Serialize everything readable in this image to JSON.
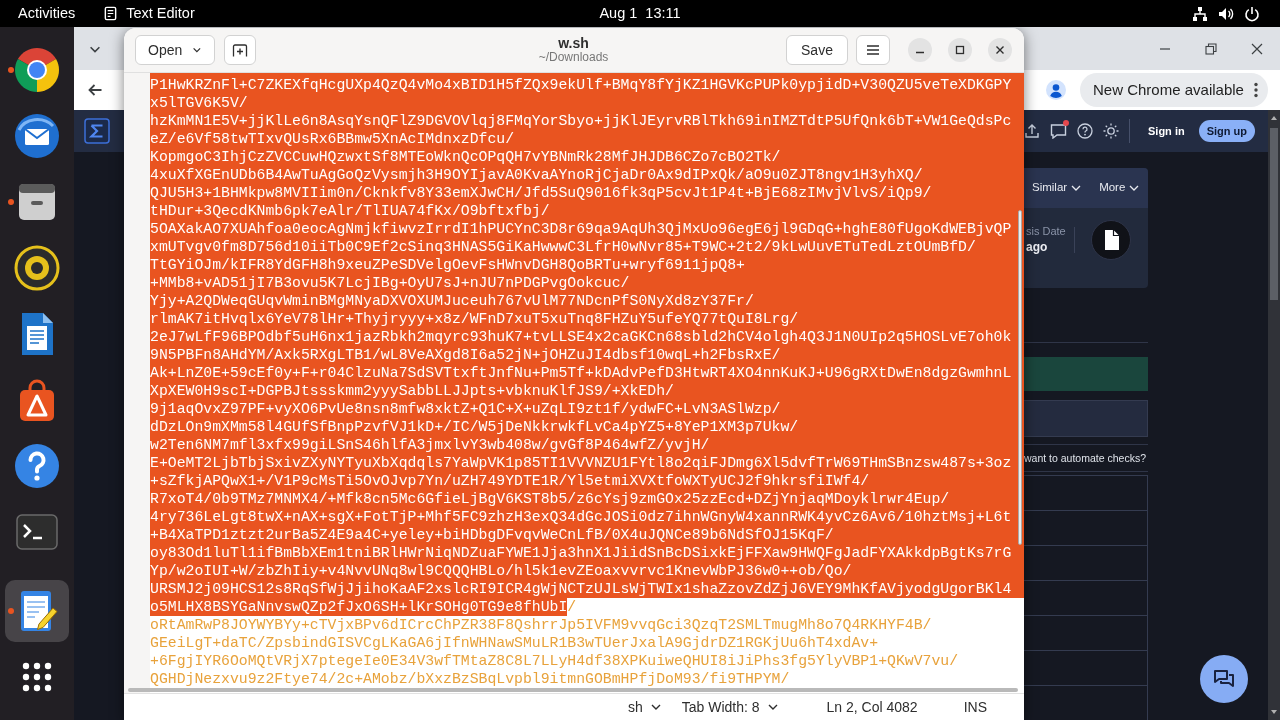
{
  "top_bar": {
    "activities": "Activities",
    "app_name": "Text Editor",
    "clock": "Aug 1  13:11"
  },
  "dock": {
    "favorites": [
      {
        "kind": "browser",
        "running": true,
        "selected": false
      },
      {
        "kind": "mail",
        "running": false,
        "selected": false
      },
      {
        "kind": "files",
        "running": true,
        "selected": false
      },
      {
        "kind": "music",
        "running": false,
        "selected": false
      },
      {
        "kind": "writer",
        "running": false,
        "selected": false
      },
      {
        "kind": "store",
        "running": false,
        "selected": false
      },
      {
        "kind": "help",
        "running": false,
        "selected": false
      },
      {
        "kind": "terminal",
        "running": false,
        "selected": false
      }
    ],
    "running_apps": [
      {
        "kind": "editor",
        "running": true,
        "selected": true
      }
    ]
  },
  "browser": {
    "update_button": "New Chrome available",
    "page": {
      "sign_in": "Sign in",
      "sign_up": "Sign up",
      "card_tabs": [
        "Similar",
        "More"
      ],
      "date_label": "sis Date",
      "date_value": "ago",
      "automate_prompt": "want to automate checks?"
    }
  },
  "editor": {
    "open_button": "Open",
    "title": "w.sh",
    "subtitle": "~/Downloads",
    "save_button": "Save",
    "lines": [
      {
        "runs": [
          {
            "text": "P1HwKRZnFl+C7ZKEXfqHcgUXp4QzQ4vMo4xBID1H5fZQx9ekUlf+BMqY8fYjKZ1HGVKcPUPk0ypjidD+V30QZU5veTeXDKGPY",
            "selected": true
          }
        ]
      },
      {
        "runs": [
          {
            "text": "x5lTGV6K5V/",
            "selected": true
          }
        ]
      },
      {
        "runs": [
          {
            "text": "hzKmMN1E5V+jjKlLe6n8AsqYsnQFlZ9DGVOVlqj8FMqYorSbyo+jjKlJEyrvRBlTkh69inIMZTdtP5UfQnk6bT+VW1GeQdsPc",
            "selected": true
          }
        ]
      },
      {
        "runs": [
          {
            "text": "eZ/e6Vf58twTIxvQUsRx6BBmw5XnAcIMdnxzDfcu/",
            "selected": true
          }
        ]
      },
      {
        "runs": [
          {
            "text": "KopmgoC3IhjCzZVCCuwHQzwxtSf8MTEoWknQcOPqQH7vYBNmRk28MfJHJDB6CZo7cBO2Tk/",
            "selected": true
          }
        ]
      },
      {
        "runs": [
          {
            "text": "4xuXfXGEnUDb6B4AwTuAgGoQzVysmjh3H9OYIjavA0KvaAYnoRjCjaDr0Ax9dIPxQk/aO9u0ZJT8ngv1H3yhXQ/",
            "selected": true
          }
        ]
      },
      {
        "runs": [
          {
            "text": "QJU5H3+1BHMkpw8MVIIim0n/Cknkfv8Y33emXJwCH/Jfd5SuQ9016fk3qP5cvJt1P4t+BjE68zIMvjVlvS/iQp9/",
            "selected": true
          }
        ]
      },
      {
        "runs": [
          {
            "text": "tHDur+3QecdKNmb6pk7eAlr/TlIUA74fKx/O9bftxfbj/",
            "selected": true
          }
        ]
      },
      {
        "runs": [
          {
            "text": "5OAXakAO7XUAhfoa0eocAgNmjkfiwvzIrrdI1hPUCYnC3D8r69qa9AqUh3QjMxUo96egE6jl9GDqG+hghE80fUgoKdWEBjvQP",
            "selected": true
          }
        ]
      },
      {
        "runs": [
          {
            "text": "xmUTvgv0fm8D756d10iiTb0C9Ef2cSinq3HNAS5GiKaHwwwC3LfrH0wNvr85+T9WC+2t2/9kLwUuvETuTedLztOUmBfD/",
            "selected": true
          }
        ]
      },
      {
        "runs": [
          {
            "text": "TtGYiOJm/kIFR8YdGFH8h9xeuZPeSDVelgOevFsHWnvDGH8QoBRTu+wryf6911jpQ8+",
            "selected": true
          }
        ]
      },
      {
        "runs": [
          {
            "text": "+MMb8+vAD51jI7B3ovu5K7LcjIBg+OyU7sJ+nJU7nPDGPvgOokcuc/",
            "selected": true
          }
        ]
      },
      {
        "runs": [
          {
            "text": "Yjy+A2QDWeqGUqvWminBMgMNyaDXVOXUMJuceuh767vUlM77NDcnPfS0NyXd8zY37Fr/",
            "selected": true
          }
        ]
      },
      {
        "runs": [
          {
            "text": "rlmAK7itHvqlx6YeV78lHr+Thyjryyy+x8z/WFnD7xuT5xuTnq8FHZuY5ufeYQ77tQuI8Lrg/",
            "selected": true
          }
        ]
      },
      {
        "runs": [
          {
            "text": "2eJ7wLfF96BPOdbf5uH6nx1jazRbkh2mqyrc93huK7+tvLLSE4x2caGKCn68sbld2hCV4olgh4Q3J1N0UIp2q5HOSLvE7oh0k",
            "selected": true
          }
        ]
      },
      {
        "runs": [
          {
            "text": "9N5PBFn8AHdYM/Axk5RXgLTB1/wL8VeAXgd8I6a52jN+jOHZuJI4dbsf10wqL+h2FbsRxE/",
            "selected": true
          }
        ]
      },
      {
        "runs": [
          {
            "text": "Ak+LnZ0E+59cEf0y+F+r04ClzuNa7SdSVTtxftJnfNu+Pm5Tf+kDAdvPefD3HtwRT4XO4nnKuKJ+U96gRXtDwEn8dgzGwmhnL",
            "selected": true
          }
        ]
      },
      {
        "runs": [
          {
            "text": "XpXEW0H9scI+DGPBJtssskmm2yyySabbLLJJpts+vbknuKlfJS9/+XkEDh/",
            "selected": true
          }
        ]
      },
      {
        "runs": [
          {
            "text": "9j1aqOvxZ97PF+vyXO6PvUe8nsn8mfw8xktZ+Q1C+X+uZqLI9zt1f/ydwFC+LvN3ASlWzp/",
            "selected": true
          }
        ]
      },
      {
        "runs": [
          {
            "text": "dDzLOn9mXMm58l4GUfSfBnpPzvfVJ1kD+/IC/W5jDeNkkrwkfLvCa4pYZ5+8YeP1XM3p7Ukw/",
            "selected": true
          }
        ]
      },
      {
        "runs": [
          {
            "text": "w2Ten6NM7mfl3xfx99giLSnS46hlfA3jmxlvY3wb408w/gvGf8P464wfZ/yvjH/",
            "selected": true
          }
        ]
      },
      {
        "runs": [
          {
            "text": "E+OeMT2LjbTbjSxivZXyNYTyuXbXqdqls7YaWpVK1p85TI1VVVNZU1FYtl8o2qiFJDmg6Xl5dvfTrW69THmSBnzsw487s+3oz",
            "selected": true
          }
        ]
      },
      {
        "runs": [
          {
            "text": "+sZfkjAPQwX1+/V1P9cMsTi5OvOJvp7Yn/uZH749YDTE1R/Yl5etmiXVXtfoWXTyUCJ2f9hkrsfiIWf4/",
            "selected": true
          }
        ]
      },
      {
        "runs": [
          {
            "text": "R7xoT4/0b9TMz7MNMX4/+Mfk8cn5Mc6GfieLjBgV6KST8b5/z6cYsj9zmGOx25zzEcd+DZjYnjaqMDoyklrwr4Eup/",
            "selected": true
          }
        ]
      },
      {
        "runs": [
          {
            "text": "4ry736LeLgt8twX+nAX+sgX+FotTjP+Mhf5FC9zhzH3exQ34dGcJOSi0dz7ihnWGnyW4xannRWK4yvCz6Av6/10hztMsj+L6t",
            "selected": true
          }
        ]
      },
      {
        "runs": [
          {
            "text": "+B4XaTPD1ztzt2urBa5Z4E9a4C+yeley+biHDbgDFvqvWeCnLfB/0X4uJQNCe89b6NdSfOJ15KqF/",
            "selected": true
          }
        ]
      },
      {
        "runs": [
          {
            "text": "oy83Od1luTl1ifBmBbXEm1tniBRlHWrNiqNDZuaFYWE1Jja3hnX1JiidSnBcDSixkEjFFXaw9HWQFgJadFYXAkkdpBgtKs7rG",
            "selected": true
          }
        ]
      },
      {
        "runs": [
          {
            "text": "Yp/w2oIUI+W/zbZhIiy+v4NvvUNq8wl9CQQQHBLo/hl5k1evZEoaxvvrvc1KnevWbPJ36w0++ob/Qo/",
            "selected": true
          }
        ]
      },
      {
        "runs": [
          {
            "text": "URSMJ2j09HCS12s8RqSfWjJjihoKaAF2xslcRI9ICR4gWjNCTzUJLsWjTWIx1shaZzovZdZjJ6VEY9MhKfAVjyodgUgorBKl4",
            "selected": true
          }
        ]
      },
      {
        "runs": [
          {
            "text": "o5MLHX8BSYGaNnvswQZp2fJxO6SH+lKrSOHg0TG9e8fhUbI",
            "selected": true
          },
          {
            "text": "/",
            "selected": false
          }
        ]
      },
      {
        "runs": [
          {
            "text": "oRtAmRwP8JOYWYBYy+cTVjxBPv6dICrcChPZR38F8QshrrJp5IVFM9vvqGci3QzqT2SMLTmugMh8o7Q4RKHYF4B/",
            "selected": false
          }
        ]
      },
      {
        "runs": [
          {
            "text": "GEeiLgT+daTC/ZpsbindGISVCgLKaGA6jIfnWHNawSMuLR1B3wTUerJxalA9GjdrDZ1RGKjUu6hT4xdAv+",
            "selected": false
          }
        ]
      },
      {
        "runs": [
          {
            "text": "+6FgjIYR6OoMQtVRjX7ptegeIe0E34V3wfTMtaZ8C8L7LLyH4df38XPKuiweQHUI8iJiPhs3fg5YlyVBP1+QKwV7vu/",
            "selected": false
          }
        ]
      },
      {
        "runs": [
          {
            "text": "QGHDjNezxvu9z2Ftye74/2c+AMobz/bXxzBzSBqLvpbl9itmnGOBmHPfjDoM93/fi9THPYM/",
            "selected": false
          }
        ]
      }
    ],
    "status_bar": {
      "language": "sh",
      "tab_width": "Tab Width: 8",
      "position": "Ln 2, Col 4082",
      "mode": "INS"
    }
  }
}
